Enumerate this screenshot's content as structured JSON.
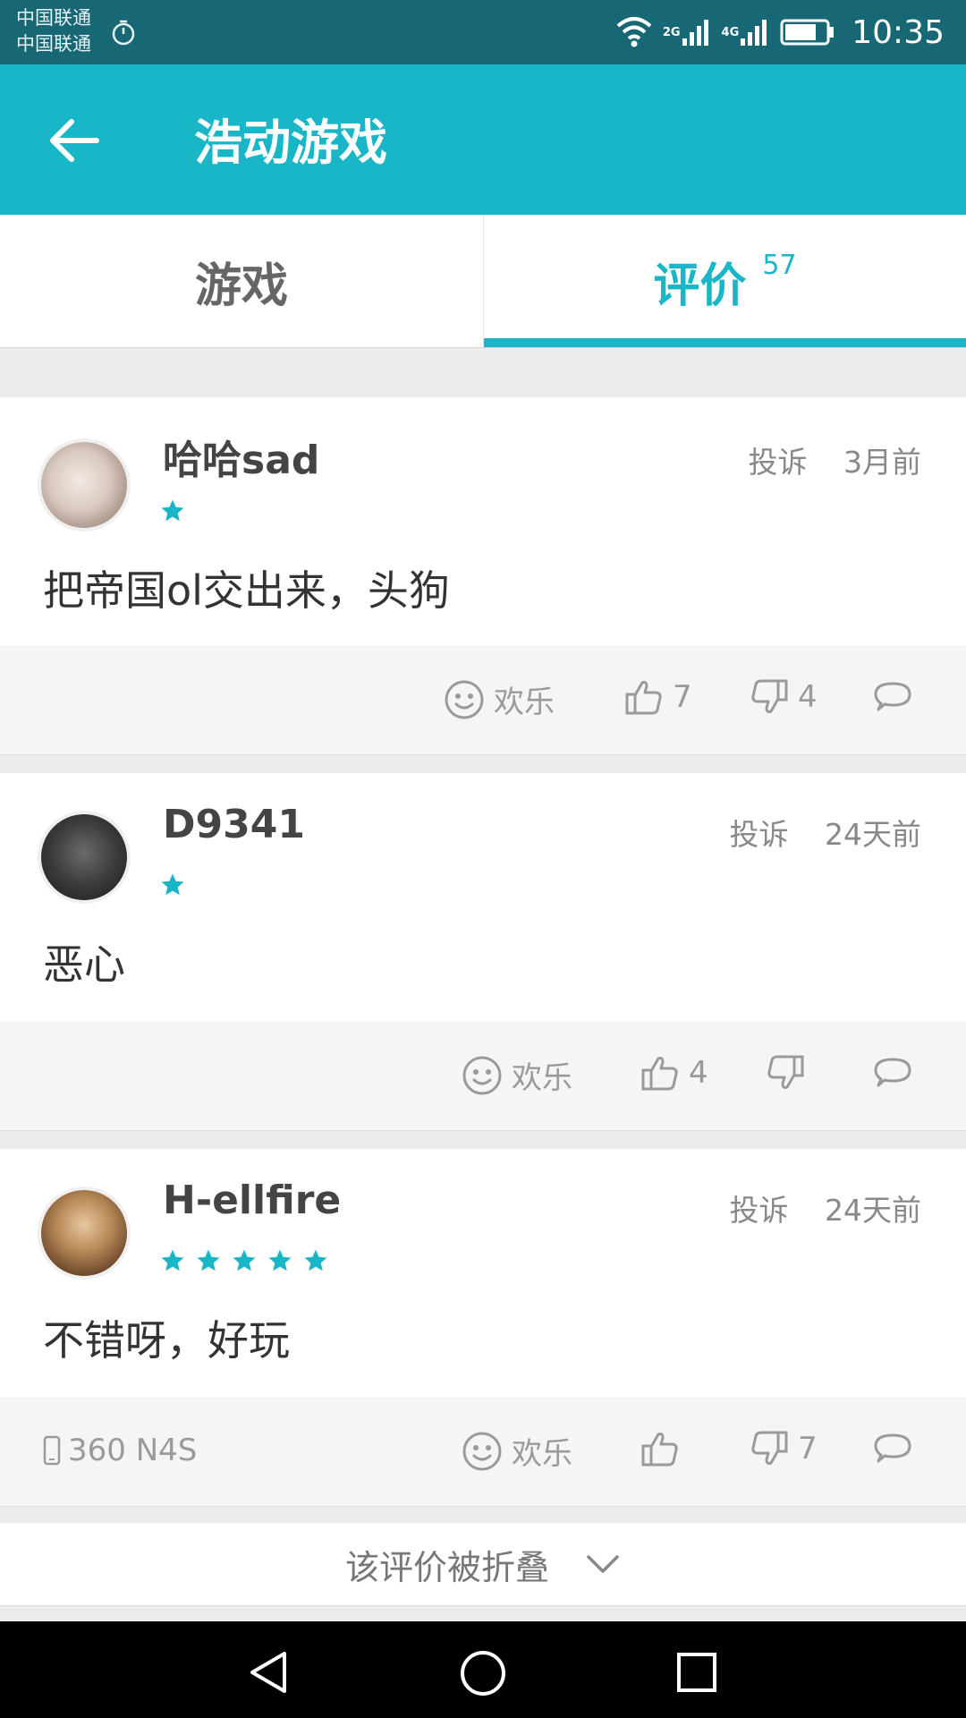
{
  "status_bar": {
    "carrier_1": "中国联通",
    "carrier_2": "中国联通",
    "network_1": "2G",
    "network_2": "4G",
    "time": "10:35"
  },
  "app_bar": {
    "title": "浩动游戏"
  },
  "tabs": {
    "game_label": "游戏",
    "review_label": "评价",
    "review_count": "57"
  },
  "reviews": [
    {
      "username": "哈哈sad",
      "report": "投诉",
      "time": "3月前",
      "stars": 1,
      "content": "把帝国ol交出来，头狗",
      "emotion": "欢乐",
      "likes": "7",
      "dislikes": "4",
      "device": ""
    },
    {
      "username": "D9341",
      "report": "投诉",
      "time": "24天前",
      "stars": 1,
      "content": "恶心",
      "emotion": "欢乐",
      "likes": "4",
      "dislikes": "",
      "device": ""
    },
    {
      "username": "H-ellfire",
      "report": "投诉",
      "time": "24天前",
      "stars": 5,
      "content": "不错呀，好玩",
      "emotion": "欢乐",
      "likes": "",
      "dislikes": "7",
      "device": "360 N4S"
    }
  ],
  "folded": {
    "label": "该评价被折叠"
  },
  "colors": {
    "accent": "#19b6c7",
    "status_bar": "#176775",
    "icon_gray": "#9a9a9a"
  }
}
